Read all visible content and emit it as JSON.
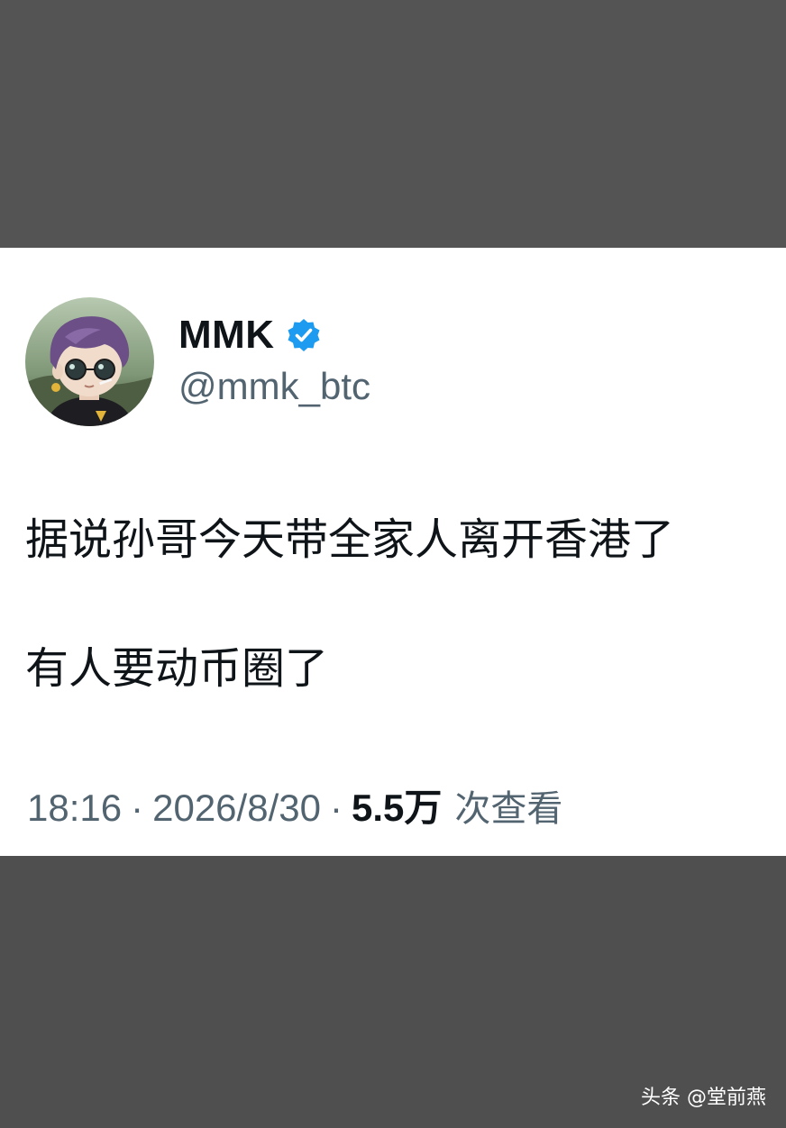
{
  "tweet": {
    "display_name": "MMK",
    "handle": "@mmk_btc",
    "lines": [
      "据说孙哥今天带全家人离开香港了",
      "有人要动币圈了"
    ],
    "time": "18:16",
    "separator": "·",
    "date": "2026/8/30",
    "views_count": "5.5万",
    "views_label": "次查看"
  },
  "icons": {
    "verified": "verified-badge-icon",
    "verified_color": "#1d9bf0"
  },
  "watermark": {
    "text": "头条 @堂前燕"
  },
  "colors": {
    "background": "#505050",
    "card": "#ffffff",
    "primary_text": "#0f1419",
    "secondary_text": "#536471",
    "accent": "#1d9bf0"
  }
}
